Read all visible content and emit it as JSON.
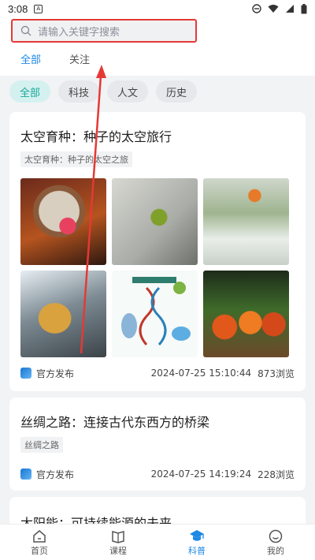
{
  "status_bar": {
    "time": "3:08",
    "notif": "A"
  },
  "search": {
    "placeholder": "请输入关键字搜索"
  },
  "tabs": [
    {
      "label": "全部"
    },
    {
      "label": "关注"
    }
  ],
  "chips": [
    {
      "label": "全部"
    },
    {
      "label": "科技"
    },
    {
      "label": "人文"
    },
    {
      "label": "历史"
    }
  ],
  "articles": [
    {
      "title": "太空育种：种子的太空旅行",
      "tag": "太空育种：种子的太空之旅",
      "source": "官方发布",
      "date": "2024-07-25 15:10:44",
      "views": "873浏览"
    },
    {
      "title": "丝绸之路：连接古代东西方的桥梁",
      "tag": "丝绸之路",
      "source": "官方发布",
      "date": "2024-07-25 14:19:24",
      "views": "228浏览"
    },
    {
      "title": "太阳能：可持续能源的未来"
    }
  ],
  "nav": [
    {
      "label": "首页",
      "icon": "home-icon"
    },
    {
      "label": "课程",
      "icon": "book-icon"
    },
    {
      "label": "科普",
      "icon": "graduation-cap-icon"
    },
    {
      "label": "我的",
      "icon": "smiley-icon"
    }
  ],
  "colors": {
    "accent": "#1e88e5",
    "chip_active": "#18a899",
    "annotation": "#e53935"
  }
}
